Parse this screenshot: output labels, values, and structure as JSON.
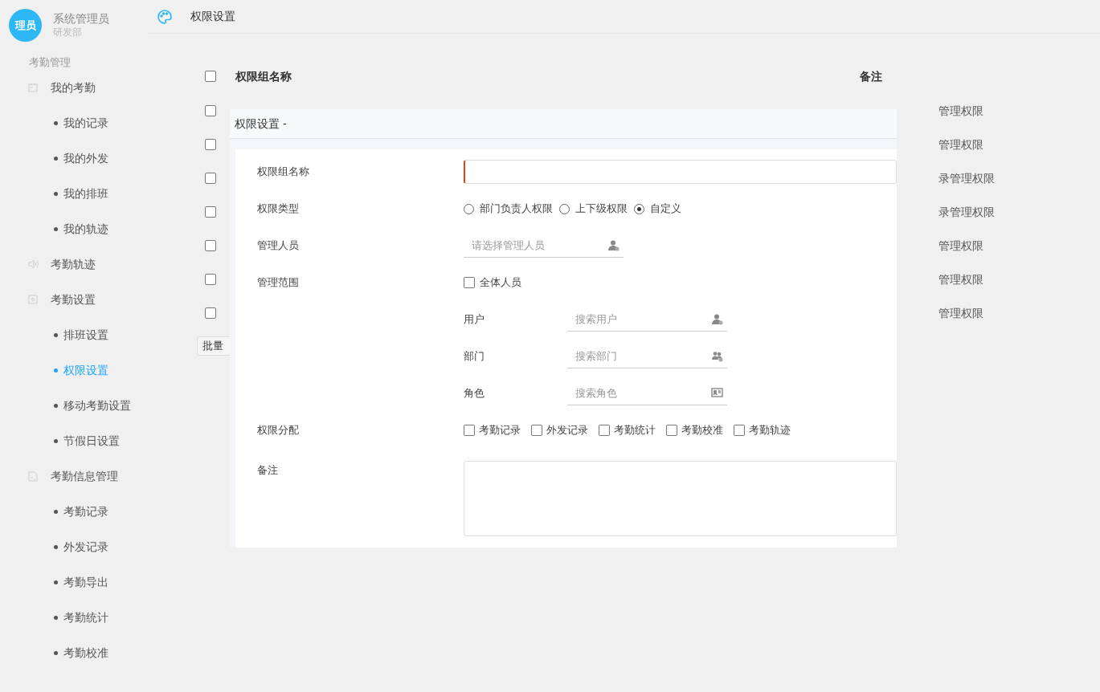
{
  "sidebar": {
    "avatar_text": "理员",
    "user_name": "系统管理员",
    "department": "研发部",
    "section_title": "考勤管理",
    "menu": [
      {
        "label": "我的考勤",
        "children": [
          {
            "label": "我的记录",
            "selected": false
          },
          {
            "label": "我的外发",
            "selected": false
          },
          {
            "label": "我的排班",
            "selected": false
          },
          {
            "label": "我的轨迹",
            "selected": false
          }
        ]
      },
      {
        "label": "考勤轨迹"
      },
      {
        "label": "考勤设置",
        "children": [
          {
            "label": "排班设置",
            "selected": false
          },
          {
            "label": "权限设置",
            "selected": true
          },
          {
            "label": "移动考勤设置",
            "selected": false
          },
          {
            "label": "节假日设置",
            "selected": false
          }
        ]
      },
      {
        "label": "考勤信息管理",
        "children": [
          {
            "label": "考勤记录",
            "selected": false
          },
          {
            "label": "外发记录",
            "selected": false
          },
          {
            "label": "考勤导出",
            "selected": false
          },
          {
            "label": "考勤统计",
            "selected": false
          },
          {
            "label": "考勤校准",
            "selected": false
          }
        ]
      }
    ]
  },
  "header": {
    "title": "权限设置"
  },
  "table": {
    "columns": [
      "权限组名称",
      "备注"
    ],
    "header_checked": false,
    "rows": [
      {
        "checked": false,
        "remark": "管理权限"
      },
      {
        "checked": false,
        "remark": "管理权限"
      },
      {
        "checked": false,
        "remark": "录管理权限"
      },
      {
        "checked": false,
        "remark": "录管理权限"
      },
      {
        "checked": false,
        "remark": "管理权限"
      },
      {
        "checked": false,
        "remark": "管理权限"
      },
      {
        "checked": false,
        "remark": "管理权限"
      }
    ],
    "bulk_button": "批量"
  },
  "dialog": {
    "title": "权限设置 -",
    "name_field": {
      "label": "权限组名称",
      "error": true
    },
    "type_field": {
      "label": "权限类型",
      "options": [
        {
          "label": "部门负责人权限",
          "selected": false
        },
        {
          "label": "上下级权限",
          "selected": false
        },
        {
          "label": "自定义",
          "selected": true
        }
      ]
    },
    "managers_field": {
      "label": "管理人员",
      "placeholder": "请选择管理人员"
    },
    "scope_field": {
      "label": "管理范围",
      "all_members": {
        "label": "全体人员",
        "checked": false
      },
      "filters": [
        {
          "kind": "user",
          "label": "用户",
          "placeholder": "搜索用户"
        },
        {
          "kind": "department",
          "label": "部门",
          "placeholder": "搜索部门"
        },
        {
          "kind": "role",
          "label": "角色",
          "placeholder": "搜索角色"
        }
      ]
    },
    "permissions_field": {
      "label": "权限分配",
      "options": [
        {
          "label": "考勤记录",
          "checked": false
        },
        {
          "label": "外发记录",
          "checked": false
        },
        {
          "label": "考勤统计",
          "checked": false
        },
        {
          "label": "考勤校准",
          "checked": false
        },
        {
          "label": "考勤轨迹",
          "checked": false
        }
      ]
    },
    "remark_field": {
      "label": "备注"
    }
  }
}
